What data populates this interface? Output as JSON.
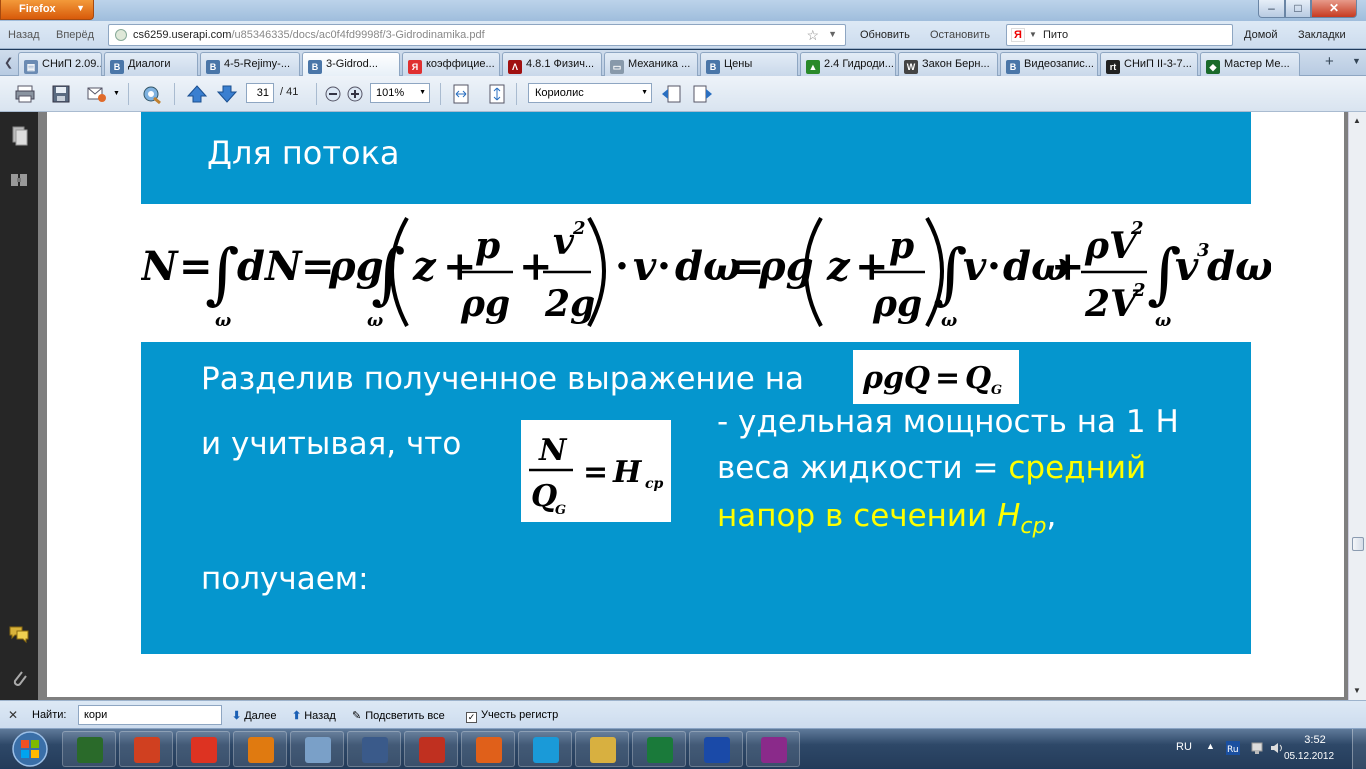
{
  "window": {
    "app_menu": "Firefox"
  },
  "nav": {
    "back": "Назад",
    "forward": "Вперёд",
    "url_host": "cs6259.userapi.com",
    "url_path": "/u85346335/docs/ac0f4fd9998f/3-Gidrodinamika.pdf",
    "reload": "Обновить",
    "stop": "Остановить",
    "search_text": "Пито",
    "home": "Домой",
    "bookmarks": "Закладки"
  },
  "tabs": [
    {
      "label": "СНиП 2.09....",
      "icon": "page-icon",
      "color": "#6b8bb3"
    },
    {
      "label": "Диалоги",
      "icon": "vk-icon",
      "color": "#4a76a8"
    },
    {
      "label": "4-5-Rejimy-...",
      "icon": "vk-icon",
      "color": "#4a76a8"
    },
    {
      "label": "3-Gidrod...",
      "icon": "vk-icon",
      "color": "#4a76a8",
      "active": true
    },
    {
      "label": "коэффицие...",
      "icon": "yandex-icon",
      "color": "#e03030"
    },
    {
      "label": "4.8.1 Физич...",
      "icon": "pdf-icon",
      "color": "#a01010"
    },
    {
      "label": "Механика ...",
      "icon": "folder-icon",
      "color": "#8899aa"
    },
    {
      "label": "Цены",
      "icon": "vk-icon",
      "color": "#4a76a8"
    },
    {
      "label": "2.4 Гидроди...",
      "icon": "globe-icon",
      "color": "#2a8a2a"
    },
    {
      "label": "Закон Берн...",
      "icon": "wikipedia-icon",
      "color": "#444444"
    },
    {
      "label": "Видеозапис...",
      "icon": "vk-icon",
      "color": "#4a76a8"
    },
    {
      "label": "СНиП II-3-7...",
      "icon": "rt-icon",
      "color": "#222222"
    },
    {
      "label": "Мастер Ме...",
      "icon": "game-icon",
      "color": "#1a6a2a"
    }
  ],
  "pdf_toolbar": {
    "page_current": "31",
    "page_total": "/ 41",
    "zoom": "101%",
    "find_text": "Кориолис"
  },
  "slide": {
    "heading": "Для потока",
    "line_divide": "Разделив полученное выражение на",
    "line_consider": "и учитывая, что",
    "specific_power": "- удельная мощность на 1 Н",
    "weight_prefix": "веса жидкости",
    "equals": "=",
    "mean_word": "средний",
    "head_line": "напор в сечении",
    "head_symbol": "H",
    "head_sub": "ср",
    "comma": ",",
    "obtain": "получаем:"
  },
  "find_bar": {
    "label": "Найти:",
    "value": "кори",
    "next": "Далее",
    "prev": "Назад",
    "highlight": "Подсветить все",
    "match_case": "Учесть регистр"
  },
  "taskbar": {
    "items": [
      "cpu-monitor-icon",
      "ccleaner-icon",
      "chrome-icon",
      "media-player-icon",
      "calculator-icon",
      "kmplayer-icon",
      "media-classic-icon",
      "firefox-icon",
      "skype-icon",
      "file-manager-icon",
      "excel-icon",
      "word-icon",
      "winrar-icon"
    ],
    "lang": "RU",
    "time": "3:52",
    "date": "05.12.2012"
  },
  "colors": {
    "slide_blue": "#0596ce",
    "highlight_yellow": "#ffff00"
  }
}
